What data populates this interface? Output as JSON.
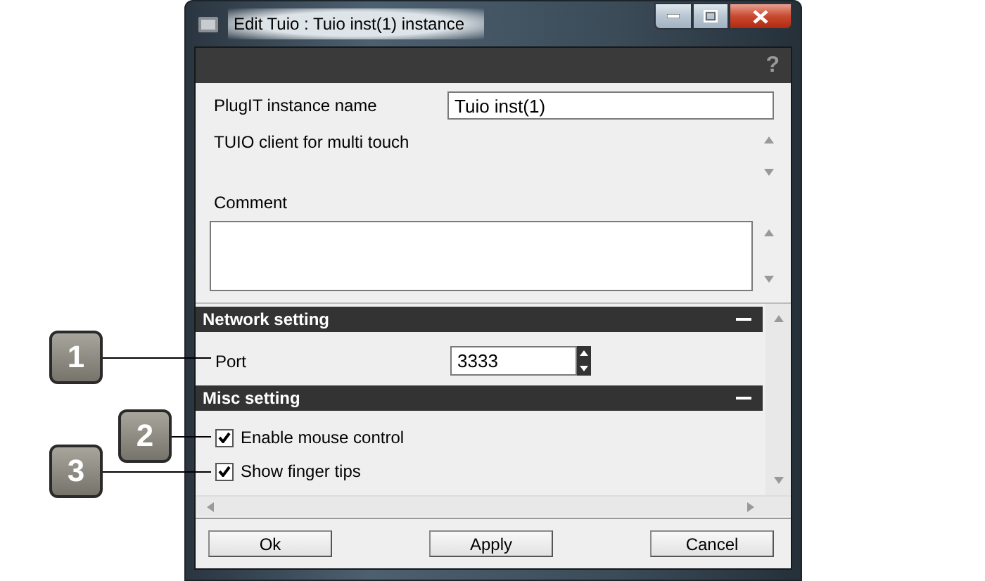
{
  "window": {
    "title": "Edit Tuio : Tuio inst(1) instance"
  },
  "help_button": "?",
  "instance_name": {
    "label": "PlugIT instance name",
    "value": "Tuio inst(1)"
  },
  "description": "TUIO client for multi touch",
  "comment": {
    "label": "Comment"
  },
  "sections": [
    {
      "title": "Network setting",
      "expanded": true,
      "items": [
        {
          "kind": "spinner",
          "label": "Port",
          "value": "3333"
        }
      ]
    },
    {
      "title": "Misc setting",
      "expanded": true,
      "items": [
        {
          "kind": "checkbox",
          "label": "Enable mouse control",
          "checked": true
        },
        {
          "kind": "checkbox",
          "label": "Show finger tips",
          "checked": true
        }
      ]
    }
  ],
  "buttons": [
    "Ok",
    "Apply",
    "Cancel"
  ],
  "callouts": [
    {
      "label": "1"
    },
    {
      "label": "2"
    },
    {
      "label": "3"
    }
  ]
}
